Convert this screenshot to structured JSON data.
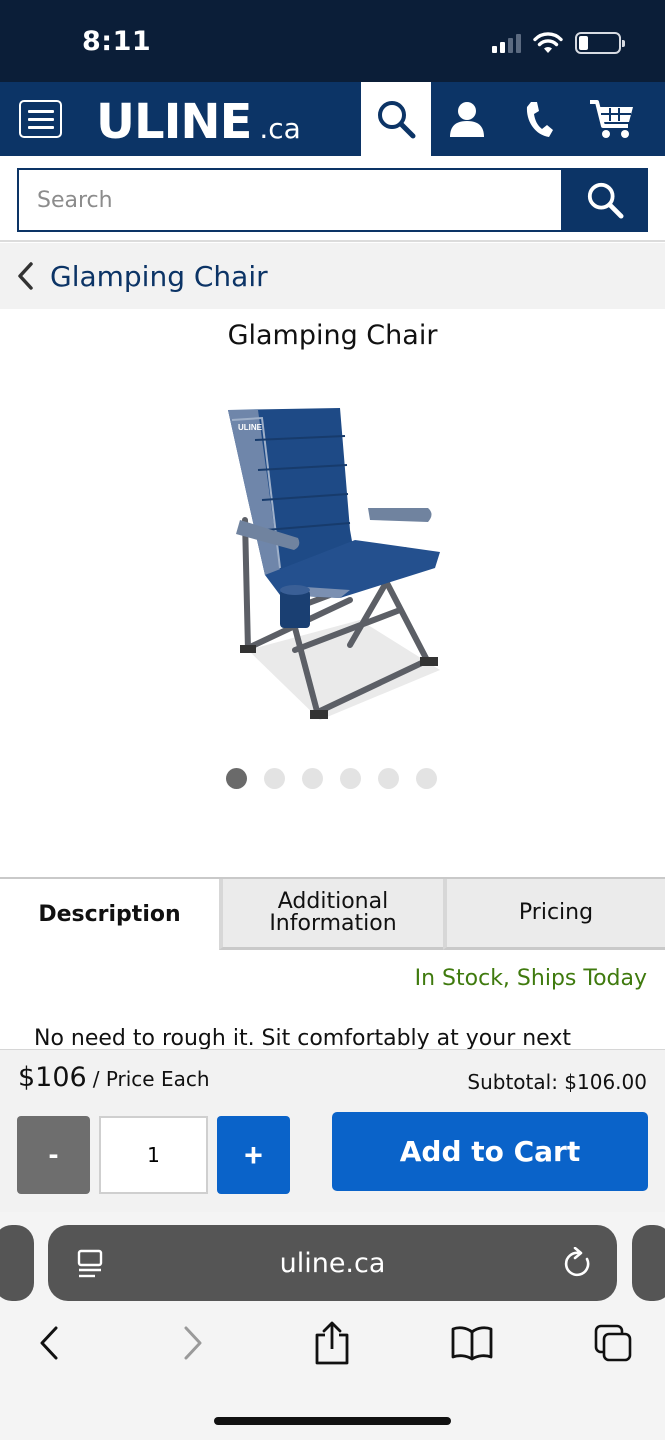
{
  "status_bar": {
    "time": "8:11"
  },
  "header": {
    "logo_main": "ULINE",
    "logo_tld": ".ca"
  },
  "search": {
    "placeholder": "Search"
  },
  "breadcrumb": {
    "label": "Glamping Chair"
  },
  "product": {
    "title": "Glamping Chair",
    "image_logo_text": "ULINE",
    "carousel_count": 6,
    "carousel_active_index": 0
  },
  "tabs": [
    {
      "label": "Description",
      "active": true
    },
    {
      "label_line1": "Additional",
      "label_line2": "Information",
      "active": false
    },
    {
      "label": "Pricing",
      "active": false
    }
  ],
  "stock_status": "In Stock, Ships Today",
  "description_preview": "No need to rough it. Sit comfortably at your next",
  "cart": {
    "price": "$106",
    "price_unit": "/ Price Each",
    "subtotal": "Subtotal: $106.00",
    "quantity": "1",
    "minus_label": "-",
    "plus_label": "+",
    "add_to_cart_label": "Add to Cart"
  },
  "browser": {
    "url": "uline.ca"
  },
  "colors": {
    "navy": "#0c3466",
    "status_bg": "#0b1e38",
    "action_blue": "#0a63c9",
    "stock_green": "#3f7a0e"
  }
}
